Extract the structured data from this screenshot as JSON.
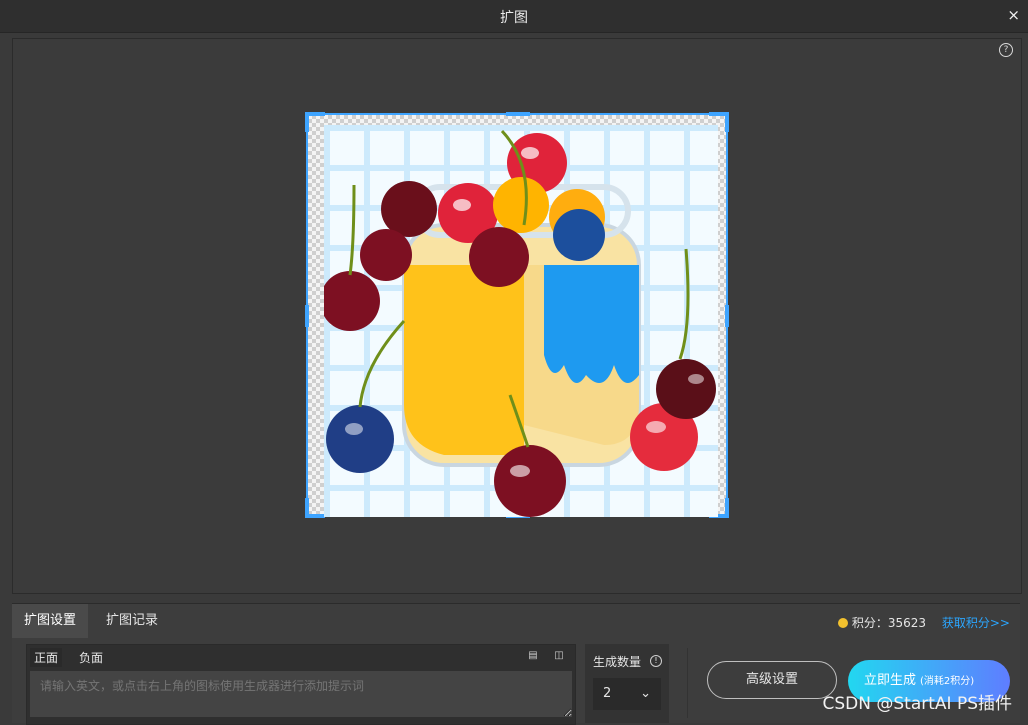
{
  "window": {
    "title": "扩图",
    "close_label": "×"
  },
  "canvas": {
    "help_icon": "question-icon"
  },
  "tabs": [
    {
      "label": "扩图设置",
      "active": true
    },
    {
      "label": "扩图记录",
      "active": false
    }
  ],
  "points": {
    "text": "积分：35623",
    "get_link": "获取积分>>"
  },
  "prompt": {
    "subtabs": [
      "正面",
      "负面"
    ],
    "placeholder": "请输入英文，或点击右上角的图标使用生成器进行添加提示词"
  },
  "count": {
    "label": "生成数量",
    "value": "2"
  },
  "buttons": {
    "advanced": "高级设置",
    "generate": "立即生成",
    "generate_note": "(消耗2积分)"
  },
  "watermark": "CSDN @StartAI PS插件",
  "colors": {
    "accent": "#3ea4ff",
    "coin": "#f2c12e"
  }
}
